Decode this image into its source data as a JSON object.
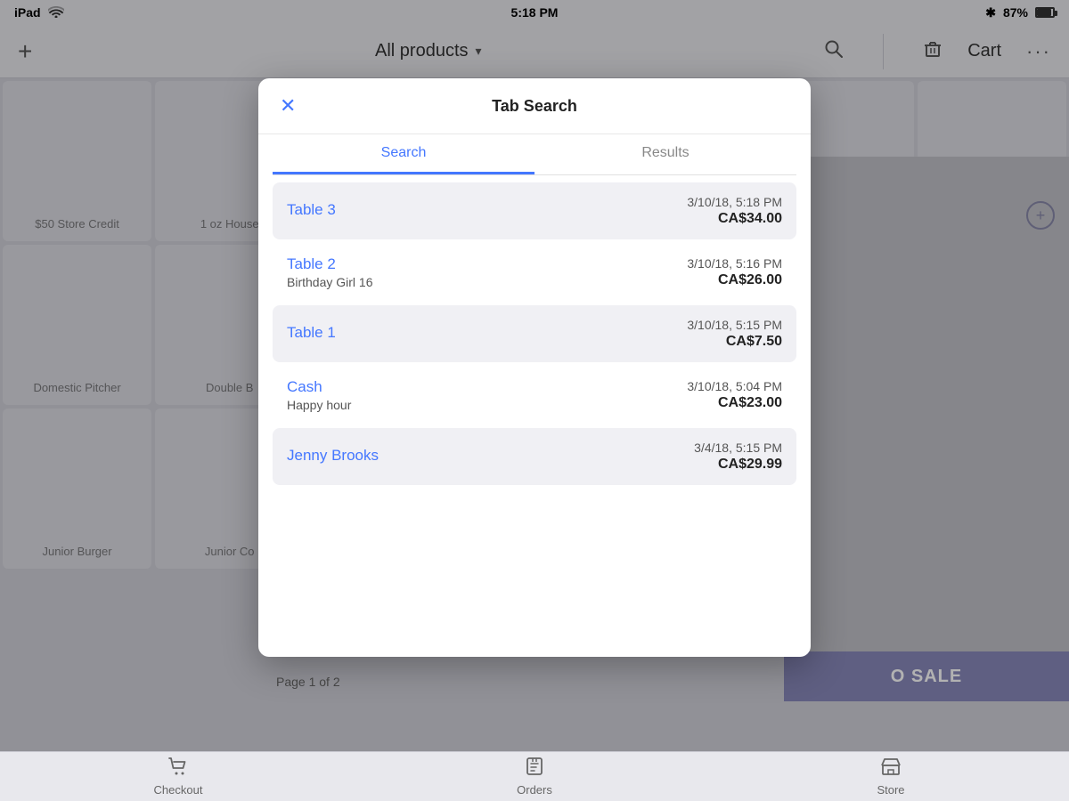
{
  "statusBar": {
    "device": "iPad",
    "wifi_icon": "wifi",
    "time": "5:18 PM",
    "bluetooth_icon": "bluetooth",
    "battery": "87%"
  },
  "navBar": {
    "plus_label": "+",
    "title": "All products",
    "dropdown_arrow": "▾",
    "search_icon": "search",
    "trash_icon": "trash",
    "cart_label": "Cart",
    "more_icon": "···"
  },
  "modal": {
    "title": "Tab Search",
    "close_icon": "×",
    "tabs": [
      {
        "label": "Search",
        "active": true
      },
      {
        "label": "Results",
        "active": false
      }
    ],
    "results": [
      {
        "name": "Table 3",
        "sub": "",
        "date": "3/10/18, 5:18 PM",
        "amount": "CA$34.00",
        "shaded": true
      },
      {
        "name": "Table 2",
        "sub": "Birthday Girl 16",
        "date": "3/10/18, 5:16 PM",
        "amount": "CA$26.00",
        "shaded": false
      },
      {
        "name": "Table 1",
        "sub": "",
        "date": "3/10/18, 5:15 PM",
        "amount": "CA$7.50",
        "shaded": true
      },
      {
        "name": "Cash",
        "sub": "Happy hour",
        "date": "3/10/18, 5:04 PM",
        "amount": "CA$23.00",
        "shaded": false
      },
      {
        "name": "Jenny Brooks",
        "sub": "",
        "date": "3/4/18, 5:15 PM",
        "amount": "CA$29.99",
        "shaded": true
      }
    ]
  },
  "backgroundProducts": [
    {
      "name": "$50 Store Credit"
    },
    {
      "name": "1 oz House"
    },
    {
      "name": ""
    },
    {
      "name": ""
    },
    {
      "name": ""
    },
    {
      "name": ""
    },
    {
      "name": ""
    },
    {
      "name": "Domestic Pitcher"
    },
    {
      "name": "Double B"
    },
    {
      "name": ""
    },
    {
      "name": ""
    },
    {
      "name": ""
    },
    {
      "name": ""
    },
    {
      "name": ""
    },
    {
      "name": "Junior Burger"
    },
    {
      "name": "Junior Co"
    },
    {
      "name": ""
    },
    {
      "name": ""
    },
    {
      "name": ""
    },
    {
      "name": ""
    },
    {
      "name": ""
    }
  ],
  "pagination": {
    "text": "Page 1 of 2"
  },
  "saleButton": {
    "label": "O SALE"
  },
  "tabBar": {
    "items": [
      {
        "icon": "🛒",
        "label": "Checkout"
      },
      {
        "icon": "📋",
        "label": "Orders"
      },
      {
        "icon": "🏪",
        "label": "Store"
      }
    ]
  }
}
